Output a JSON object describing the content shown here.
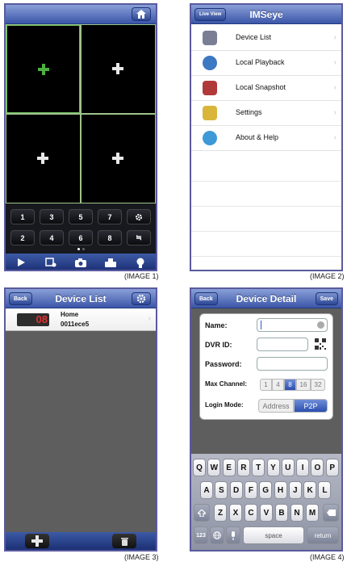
{
  "captions": {
    "p1": "(IMAGE 1)",
    "p2": "(IMAGE 2)",
    "p3": "(IMAGE 3)",
    "p4": "(IMAGE 4)"
  },
  "live": {
    "keys_row1": [
      "1",
      "3",
      "5",
      "7",
      "*"
    ],
    "keys_row2": [
      "2",
      "4",
      "6",
      "8",
      "≒"
    ],
    "toolbar_icons": [
      "play-icon",
      "playback-icon",
      "camera-icon",
      "ptz-icon",
      "lightbulb-icon"
    ]
  },
  "menu": {
    "title": "IMSeye",
    "live_view_button": "Live View",
    "items": [
      {
        "label": "Device List",
        "icon": "device-list-icon",
        "color": "#7a7f96"
      },
      {
        "label": "Local Playback",
        "icon": "local-playback-icon",
        "color": "#3d78c2"
      },
      {
        "label": "Local Snapshot",
        "icon": "local-snapshot-icon",
        "color": "#b03a3a"
      },
      {
        "label": "Settings",
        "icon": "settings-icon",
        "color": "#d9b53a"
      },
      {
        "label": "About & Help",
        "icon": "about-help-icon",
        "color": "#3d9ad6"
      }
    ]
  },
  "device_list": {
    "title": "Device List",
    "back_button": "Back",
    "device": {
      "name": "Home",
      "id": "0011ece5",
      "badge": "08"
    }
  },
  "device_detail": {
    "title": "Device Detail",
    "back_button": "Back",
    "save_button": "Save",
    "labels": {
      "name": "Name:",
      "dvr_id": "DVR ID:",
      "password": "Password:",
      "max_channel": "Max Channel:",
      "login_mode": "Login Mode:"
    },
    "channels": [
      "1",
      "4",
      "8",
      "16",
      "32"
    ],
    "selected_channel": "8",
    "login_modes": [
      "Address",
      "P2P"
    ],
    "selected_login_mode": "P2P",
    "keyboard": {
      "row1": [
        "Q",
        "W",
        "E",
        "R",
        "T",
        "Y",
        "U",
        "I",
        "O",
        "P"
      ],
      "row2": [
        "A",
        "S",
        "D",
        "F",
        "G",
        "H",
        "J",
        "K",
        "L"
      ],
      "row3": [
        "Z",
        "X",
        "C",
        "V",
        "B",
        "N",
        "M"
      ],
      "numbers_key": "123",
      "space_key": "space",
      "return_key": "return"
    }
  }
}
